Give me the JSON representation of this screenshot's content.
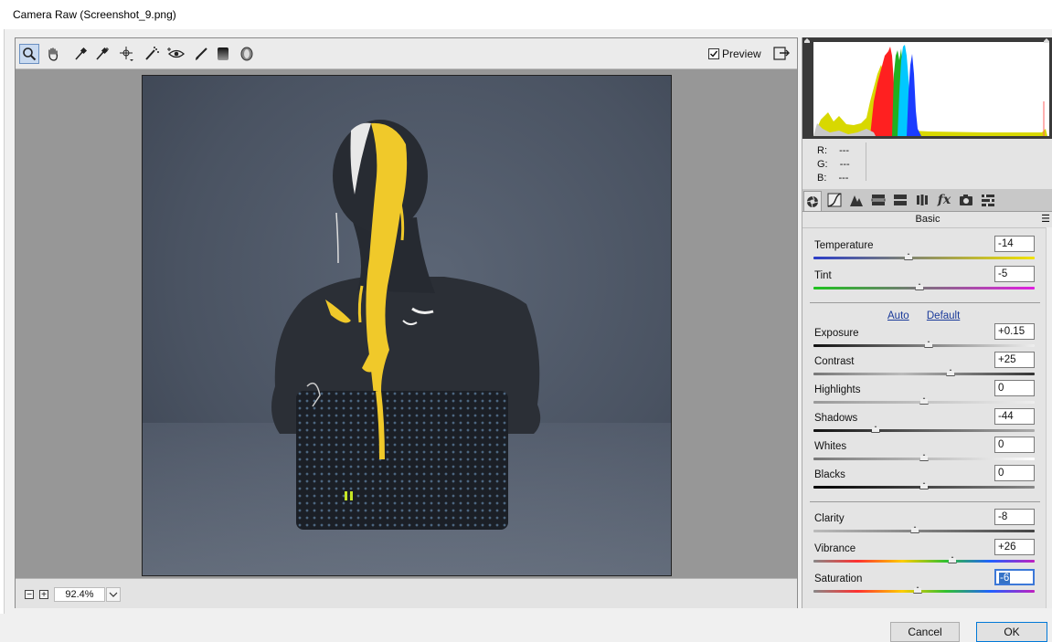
{
  "window": {
    "title": "Camera Raw (Screenshot_9.png)"
  },
  "toolbar": {
    "tools": [
      "zoom-icon",
      "hand-icon",
      "white-balance-icon",
      "color-sampler-icon",
      "targeted-adjust-icon",
      "spot-removal-icon",
      "red-eye-icon",
      "adjustment-brush-icon",
      "graduated-filter-icon",
      "radial-filter-icon"
    ],
    "preview_label": "Preview",
    "preview_checked": true
  },
  "status": {
    "zoom": "92.4%"
  },
  "info": {
    "r_label": "R:",
    "r_value": "---",
    "g_label": "G:",
    "g_value": "---",
    "b_label": "B:",
    "b_value": "---"
  },
  "panel": {
    "title": "Basic",
    "auto_label": "Auto",
    "default_label": "Default",
    "tabs": [
      "basic-icon",
      "tone-curve-icon",
      "detail-icon",
      "hsl-icon",
      "split-toning-icon",
      "lens-icon",
      "effects-icon",
      "camera-calibration-icon",
      "presets-icon"
    ],
    "params": {
      "temperature": {
        "label": "Temperature",
        "value": "-14",
        "level": 0.43
      },
      "tint": {
        "label": "Tint",
        "value": "-5",
        "level": 0.48
      },
      "exposure": {
        "label": "Exposure",
        "value": "+0.15",
        "level": 0.52
      },
      "contrast": {
        "label": "Contrast",
        "value": "+25",
        "level": 0.62
      },
      "highlights": {
        "label": "Highlights",
        "value": "0",
        "level": 0.5
      },
      "shadows": {
        "label": "Shadows",
        "value": "-44",
        "level": 0.28
      },
      "whites": {
        "label": "Whites",
        "value": "0",
        "level": 0.5
      },
      "blacks": {
        "label": "Blacks",
        "value": "0",
        "level": 0.5
      },
      "clarity": {
        "label": "Clarity",
        "value": "-8",
        "level": 0.46
      },
      "vibrance": {
        "label": "Vibrance",
        "value": "+26",
        "level": 0.63
      },
      "saturation": {
        "label": "Saturation",
        "value": "-6",
        "level": 0.47
      }
    }
  },
  "buttons": {
    "cancel": "Cancel",
    "ok": "OK"
  },
  "colors": {
    "accent": "#3572c6",
    "photo_bg": "#4b5462",
    "paint": "#f0c92a"
  }
}
